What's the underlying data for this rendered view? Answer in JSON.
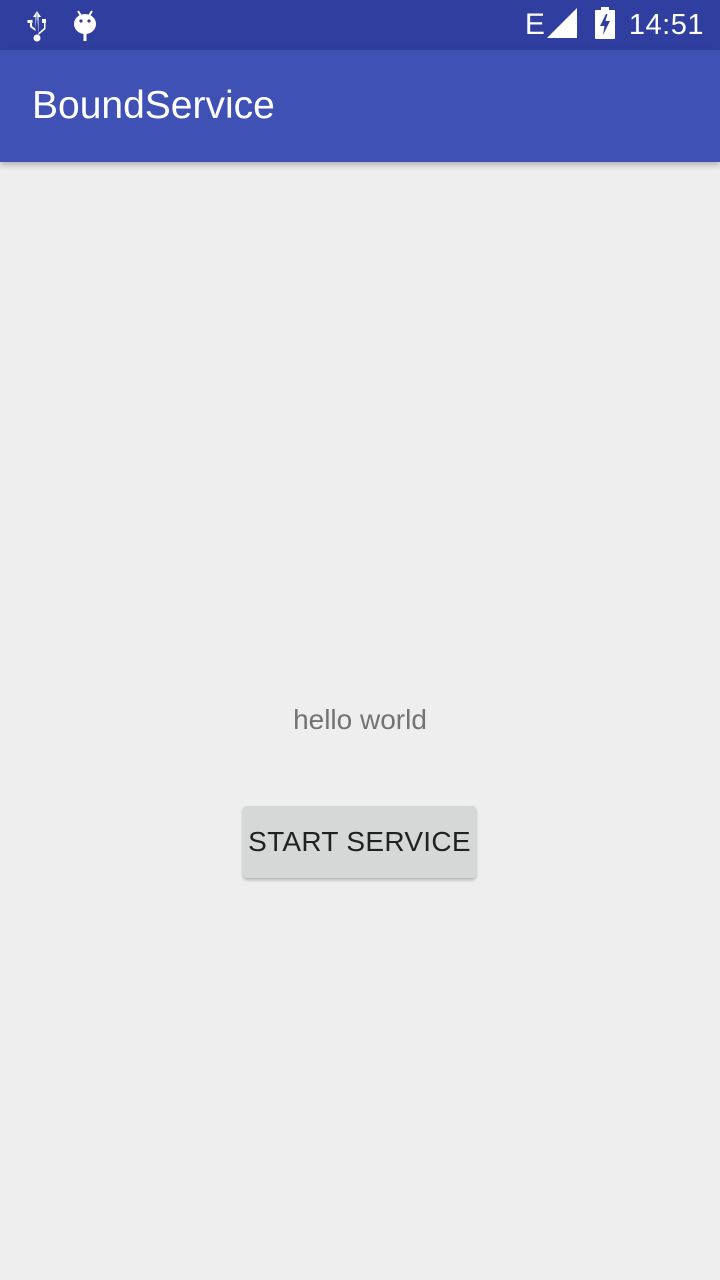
{
  "status_bar": {
    "icons_left": [
      "usb-icon",
      "android-debug-icon"
    ],
    "network_type": "E",
    "signal_icon": "cell-signal-icon",
    "battery_icon": "battery-charging-icon",
    "time": "14:51",
    "background_color": "#303f9f"
  },
  "app_bar": {
    "title": "BoundService",
    "background_color": "#3f51b5"
  },
  "main": {
    "hello_text": "hello world",
    "start_button_label": "START SERVICE"
  }
}
